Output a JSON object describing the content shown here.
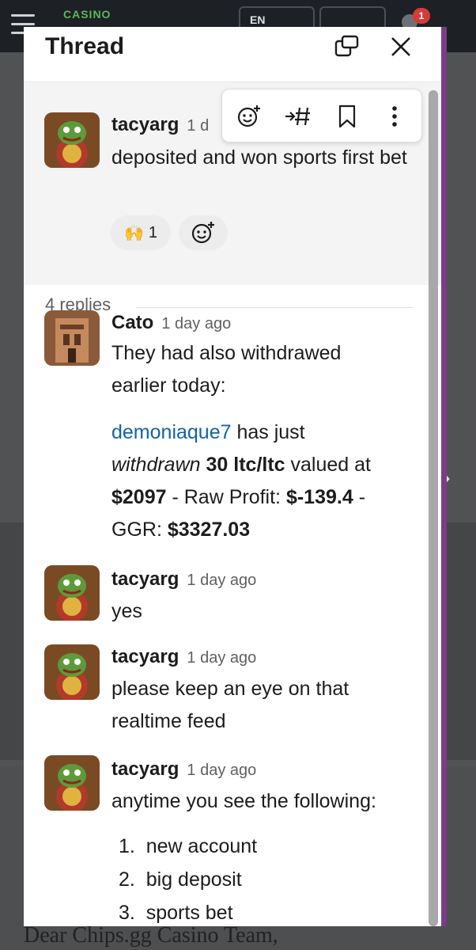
{
  "background": {
    "logo_text": "CASINO",
    "lang_label": "EN",
    "notification_count": "1",
    "footer_text": "Dear Chips.gg Casino Team,"
  },
  "thread": {
    "title": "Thread",
    "parent": {
      "author": "tacyarg",
      "time": "1 d",
      "text": "deposited and won sports first bet",
      "reaction_emoji": "🙌",
      "reaction_count": "1"
    },
    "replies_label": "4 replies",
    "replies": [
      {
        "author": "Cato",
        "time": "1 day ago",
        "text_line1": "They had also withdrawed",
        "text_line2": "earlier today:",
        "feed": {
          "mention": "demoniaque7",
          "has_just": " has just",
          "withdrawn": "withdrawn",
          "amount": "30 ltc/ltc",
          "valued_at": " valued at",
          "value": "$2097",
          "raw_label": " - Raw Profit: ",
          "raw_value": "$-139.4",
          "dash": " -",
          "ggr_label": "GGR: ",
          "ggr_value": "$3327.03"
        }
      },
      {
        "author": "tacyarg",
        "time": "1 day ago",
        "text": "yes"
      },
      {
        "author": "tacyarg",
        "time": "1 day ago",
        "text_line1": "please keep an eye on that",
        "text_line2": "realtime feed"
      },
      {
        "author": "tacyarg",
        "time": "1 day ago",
        "text": "anytime you see the following:",
        "list": [
          "new account",
          "big deposit",
          "sports bet"
        ]
      }
    ]
  },
  "icons": {
    "emoji_add": "add-reaction-icon",
    "forward": "forward-to-channel-icon",
    "bookmark": "bookmark-icon",
    "more": "more-actions-icon",
    "expand": "expand-window-icon",
    "close": "close-icon"
  },
  "colors": {
    "mention": "#1264a3",
    "accent": "#7a3d8a",
    "parent_bg": "#f4f4f4"
  }
}
